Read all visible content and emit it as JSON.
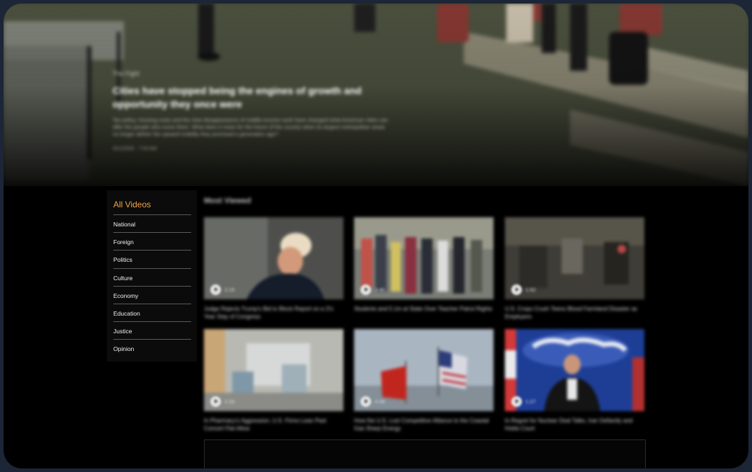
{
  "hero": {
    "kicker": "The Fight",
    "title": "Cities have stopped being the engines of growth and opportunity they once were",
    "description": "Tax policy, housing costs and the slow disappearance of middle-income work have changed what American cities can offer the people who move there. What does it mean for the future of the country when its largest metropolitan areas no longer deliver the upward mobility they promised a generation ago?",
    "meta": "3/11/2025 · 7:03 AM"
  },
  "sidebar": {
    "title": "All Videos",
    "items": [
      {
        "label": "National"
      },
      {
        "label": "Foreign"
      },
      {
        "label": "Politics"
      },
      {
        "label": "Culture"
      },
      {
        "label": "Economy"
      },
      {
        "label": "Education"
      },
      {
        "label": "Justice"
      },
      {
        "label": "Opinion"
      }
    ]
  },
  "main": {
    "section_title": "Most Viewed",
    "videos": [
      {
        "duration": "2:15",
        "caption": "Judge Rejects Trump's Bid to Block Report on a 2½ Year Stay of Congress"
      },
      {
        "duration": "3:40",
        "caption": "Students and 5.1m at State Over Teacher Patrol Rights"
      },
      {
        "duration": "1:52",
        "caption": "U.S. Crops Crush Teens Blood Farmland Disaster as Employers"
      },
      {
        "duration": "2:33",
        "caption": "In Pharmacy's Aggression, U.S. Firms Lean Past Concert Flat Allow"
      },
      {
        "duration": "4:08",
        "caption": "How the U.S. Lost Competitive Alliance to the Coastal Gas Sharp Energy"
      },
      {
        "duration": "1:27",
        "caption": "In Regret for Nuclear Deal Talks, Iran Defiantly and Holds Court"
      }
    ]
  },
  "colors": {
    "accent": "#f2a444",
    "background": "#000000",
    "frame": "#1c2637"
  }
}
